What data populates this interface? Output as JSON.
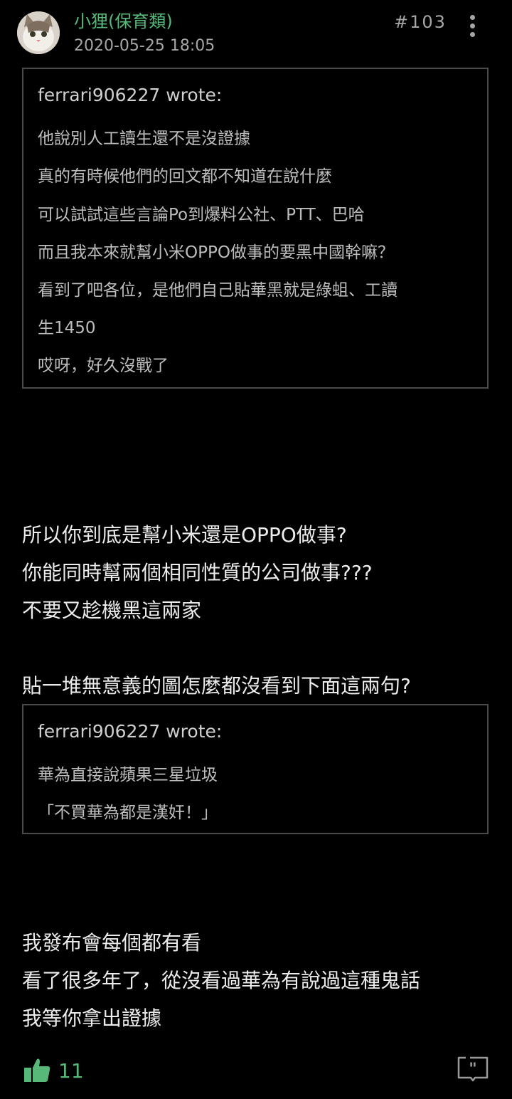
{
  "post": {
    "author": "小狸(保育類)",
    "timestamp": "2020-05-25 18:05",
    "floor": "#103",
    "likes": "11"
  },
  "quote1": {
    "author": "ferrari906227  wrote:",
    "lines": [
      "他說別人工讀生還不是沒證據",
      "真的有時候他們的回文都不知道在說什麼",
      "可以試試這些言論Po到爆料公社、PTT、巴哈",
      "而且我本來就幫小米OPPO做事的要黑中國幹嘛？",
      "看到了吧各位，是他們自己貼華黑就是綠蛆、工讀",
      "生1450",
      "哎呀，好久沒戰了"
    ]
  },
  "body1": [
    "所以你到底是幫小米還是OPPO做事?",
    "你能同時幫兩個相同性質的公司做事???",
    "不要又趁機黑這兩家"
  ],
  "body2": "貼一堆無意義的圖怎麼都沒看到下面這兩句?",
  "quote2": {
    "author": "ferrari906227  wrote:",
    "lines": [
      "華為直接說蘋果三星垃圾",
      "「不買華為都是漢奸！」"
    ]
  },
  "body3": [
    "我發布會每個都有看",
    "看了很多年了，從沒看過華為有說過這種鬼話",
    "我等你拿出證據"
  ],
  "icons": {
    "avatar": "cat-avatar",
    "more": "more-vertical-icon",
    "like": "thumbs-up-icon",
    "reply": "quote-reply-icon"
  },
  "colors": {
    "accent": "#58b87a",
    "background": "#000000"
  }
}
